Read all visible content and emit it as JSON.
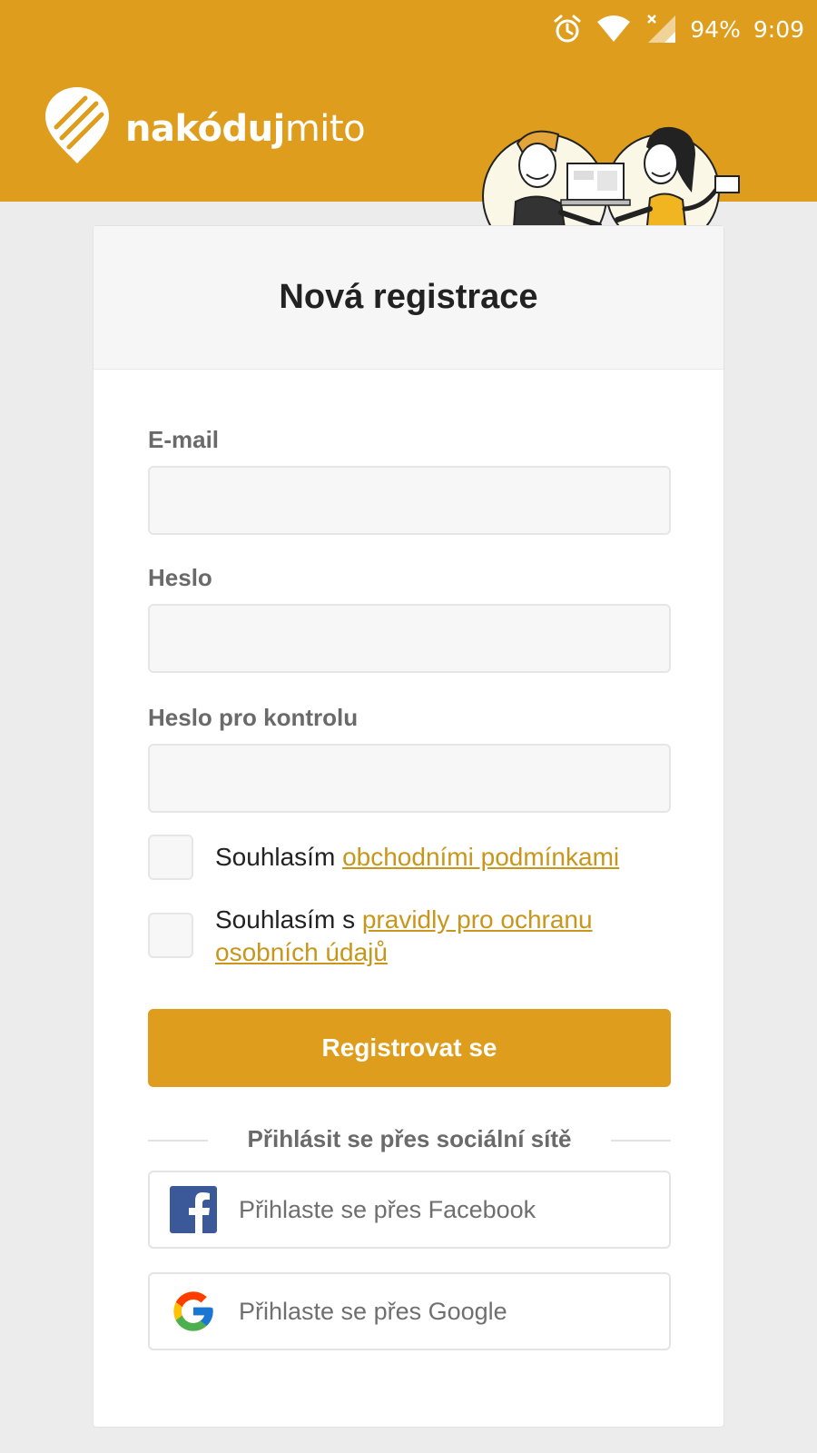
{
  "status_bar": {
    "battery": "94%",
    "time": "9:09",
    "icons": [
      "alarm-icon",
      "wifi-icon",
      "cellular-icon"
    ]
  },
  "brand": {
    "name_bold": "nakódu",
    "name_mid": "j",
    "name_light": "mito",
    "icon": "brand-logo-icon"
  },
  "form": {
    "title": "Nová registrace",
    "email_label": "E-mail",
    "email_value": "",
    "password_label": "Heslo",
    "password_value": "",
    "password_confirm_label": "Heslo pro kontrolu",
    "password_confirm_value": "",
    "terms_prefix": "Souhlasím ",
    "terms_link": "obchodními podmínkami",
    "terms_checked": false,
    "privacy_prefix": "Souhlasím s ",
    "privacy_link": "pravidly pro ochranu osobních údajů",
    "privacy_checked": false,
    "register_label": "Registrovat se"
  },
  "social": {
    "divider_text": "Přihlásit se přes sociální sítě",
    "facebook_label": "Přihlaste se přes Facebook",
    "google_label": "Přihlaste se přes Google"
  },
  "colors": {
    "accent": "#de9d1c",
    "link": "#c9961c",
    "background": "#ececec",
    "facebook": "#3b5998"
  }
}
